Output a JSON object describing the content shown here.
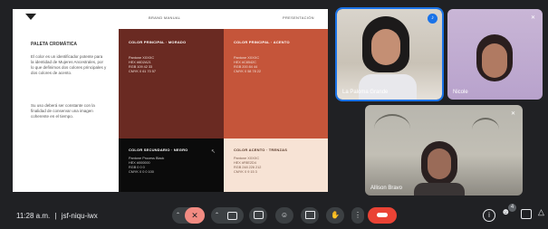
{
  "slide": {
    "header_center": "BRAND MANUAL",
    "header_right": "PRESENTACIÓN",
    "left_title": "PALETA CROMÁTICA",
    "left_para1": "El color es un identificador potente para la identidad de Mujeres Ancestrales, por lo que definimos dos colores principales y dos colores de acento.",
    "left_para2": "Su uso deberá ser constante con la finalidad de conservar una imagen coherente en el tiempo.",
    "panels": [
      {
        "title": "COLOR PRINCIPAL · MORADO",
        "lines": "Pantone XXXXC\nHEX #6D2A21\nRGB 109 42 33\nCMYK 0 61 70 57",
        "bg": "#6a2a22"
      },
      {
        "title": "COLOR PRINCIPAL · ACENTO",
        "lines": "Pantone XXXXC\nHEX #C8542C\nRGB 200 84 44\nCMYK 0 58 78 22",
        "bg": "#c5553a"
      },
      {
        "title": "COLOR SECUNDARIO · NEGRO",
        "lines": "Pantone Process Black\nHEX #000000\nRGB 0 0 0\nCMYK 0 0 0 100",
        "bg": "#0b0b0b"
      },
      {
        "title": "COLOR ACENTO · TRENZAS",
        "lines": "Pantone XXXXC\nHEX #F8E2D4\nRGB 248 226 212\nCMYK 0 9 15 3",
        "bg": "#f7e3d5"
      }
    ]
  },
  "participants": [
    {
      "name": "La Paloma Grande",
      "mic": "speaking"
    },
    {
      "name": "Nicole",
      "mic": "muted"
    },
    {
      "name": "Allison Bravo",
      "mic": "muted"
    }
  ],
  "meeting": {
    "time": "11:28 a.m.",
    "separator": "|",
    "code": "jsf-niqu-iwx",
    "people_count": "4"
  },
  "colors": {
    "end_call": "#ea4335",
    "muted_mic": "#f28b82",
    "speaking": "#1a73e8"
  },
  "icons": [
    "raise-chevron-icon",
    "mic-off-icon",
    "camera-icon",
    "captions-icon",
    "emoji-icon",
    "present-icon",
    "hand-icon",
    "more-icon",
    "end-call-icon",
    "info-icon",
    "people-icon",
    "chat-icon",
    "activities-icon"
  ]
}
